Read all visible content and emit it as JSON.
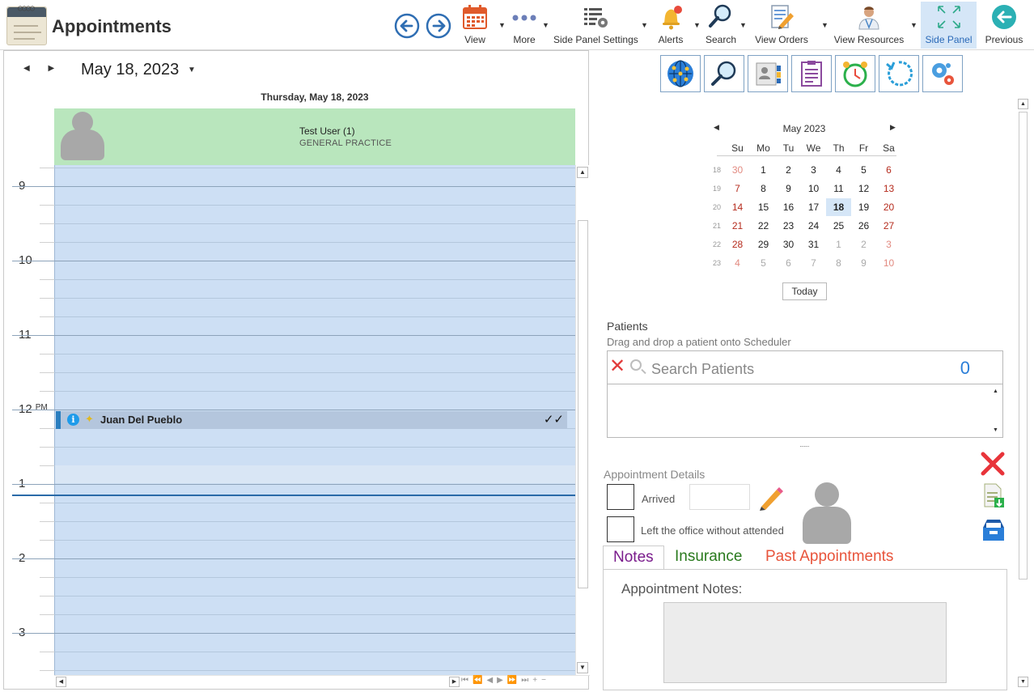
{
  "app": {
    "title": "Appointments"
  },
  "toolbar": {
    "view": "View",
    "more": "More",
    "side_panel_settings": "Side Panel Settings",
    "alerts": "Alerts",
    "search": "Search",
    "view_orders": "View Orders",
    "view_resources": "View Resources",
    "side_panel": "Side Panel",
    "previous": "Previous"
  },
  "scheduler": {
    "current_date": "May 18, 2023",
    "day_header": "Thursday, May 18, 2023",
    "resource": {
      "name": "Test User (1)",
      "department": "GENERAL PRACTICE"
    },
    "hours": [
      {
        "label": "9",
        "suffix": ""
      },
      {
        "label": "10",
        "suffix": ""
      },
      {
        "label": "11",
        "suffix": ""
      },
      {
        "label": "12",
        "suffix": "PM"
      },
      {
        "label": "1",
        "suffix": ""
      },
      {
        "label": "2",
        "suffix": ""
      },
      {
        "label": "3",
        "suffix": ""
      }
    ],
    "appointment": {
      "patient": "Juan Del Pueblo",
      "info_glyph": "i",
      "status_glyph": "✓✓"
    }
  },
  "calendar": {
    "month_title": "May 2023",
    "weekdays": [
      "Su",
      "Mo",
      "Tu",
      "We",
      "Th",
      "Fr",
      "Sa"
    ],
    "weeks": [
      {
        "wk": "18",
        "days": [
          "30",
          "1",
          "2",
          "3",
          "4",
          "5",
          "6"
        ]
      },
      {
        "wk": "19",
        "days": [
          "7",
          "8",
          "9",
          "10",
          "11",
          "12",
          "13"
        ]
      },
      {
        "wk": "20",
        "days": [
          "14",
          "15",
          "16",
          "17",
          "18",
          "19",
          "20"
        ]
      },
      {
        "wk": "21",
        "days": [
          "21",
          "22",
          "23",
          "24",
          "25",
          "26",
          "27"
        ]
      },
      {
        "wk": "22",
        "days": [
          "28",
          "29",
          "30",
          "31",
          "1",
          "2",
          "3"
        ]
      },
      {
        "wk": "23",
        "days": [
          "4",
          "5",
          "6",
          "7",
          "8",
          "9",
          "10"
        ]
      }
    ],
    "selected_day": "18",
    "today_button": "Today"
  },
  "patients": {
    "label": "Patients",
    "hint": "Drag and drop a patient onto Scheduler",
    "search_placeholder": "Search Patients",
    "count": "0"
  },
  "appointment_details": {
    "label": "Appointment Details",
    "arrived_label": "Arrived",
    "left_label": "Left the office without attended",
    "tabs": [
      {
        "label": "Notes",
        "color": "#7a1c8c"
      },
      {
        "label": "Insurance",
        "color": "#2a7a1e"
      },
      {
        "label": "Past Appointments",
        "color": "#e8543b"
      }
    ],
    "notes_label": "Appointment Notes:"
  },
  "colors": {
    "accent_blue": "#2a6ab8",
    "resource_green": "#b9e6bd",
    "slot_blue": "#cddff4",
    "weekend_red": "#b52b1d"
  }
}
